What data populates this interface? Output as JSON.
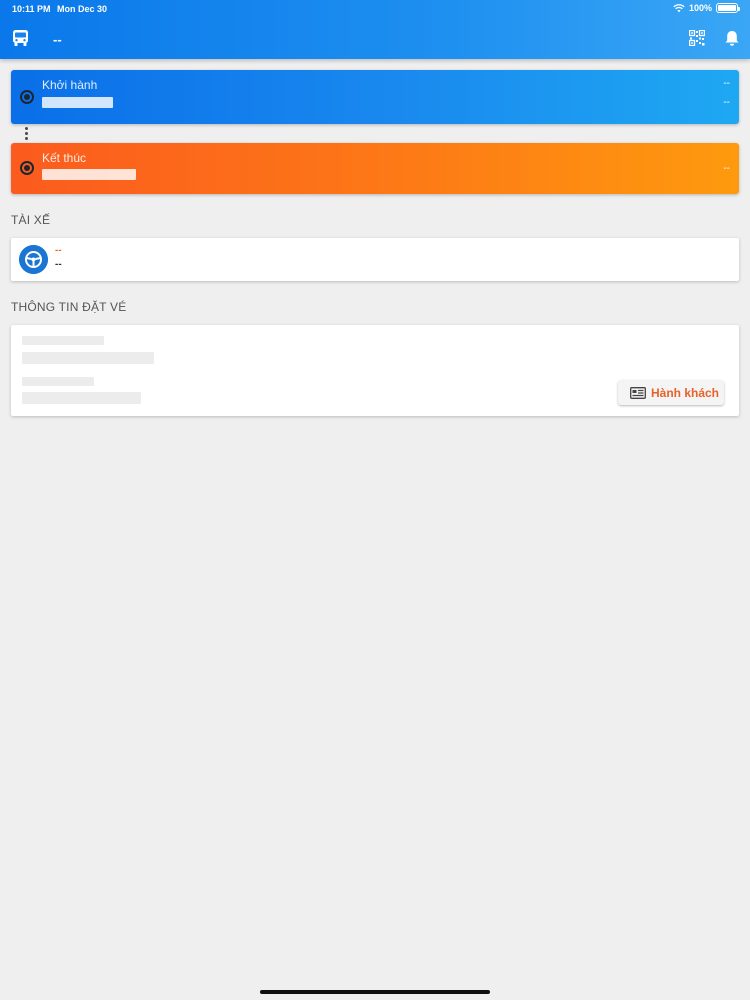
{
  "status_bar": {
    "time": "10:11 PM",
    "date": "Mon Dec 30",
    "battery": "100%",
    "battery_level": 1.0
  },
  "header": {
    "title": "--",
    "icons": {
      "left": "bus-icon",
      "qr": "qr-code-icon",
      "bell": "bell-icon"
    },
    "color": "#0a78ea"
  },
  "trip": {
    "departure": {
      "label": "Khởi hành",
      "time_value": "--",
      "date_value": "--",
      "color": "#0a6fe8"
    },
    "arrival": {
      "label": "Kết thúc",
      "time_value": "--",
      "color": "#fb5b1e"
    }
  },
  "driver_section": {
    "title": "TÀI XẾ",
    "name": "--",
    "phone": "--",
    "icon": "steering-wheel-icon"
  },
  "booking_section": {
    "title": "THÔNG TIN ĐẶT VÉ",
    "passenger_button_label": "Hành khách",
    "passenger_button_icon": "ticket-list-icon",
    "accent_color": "#e8612a"
  }
}
